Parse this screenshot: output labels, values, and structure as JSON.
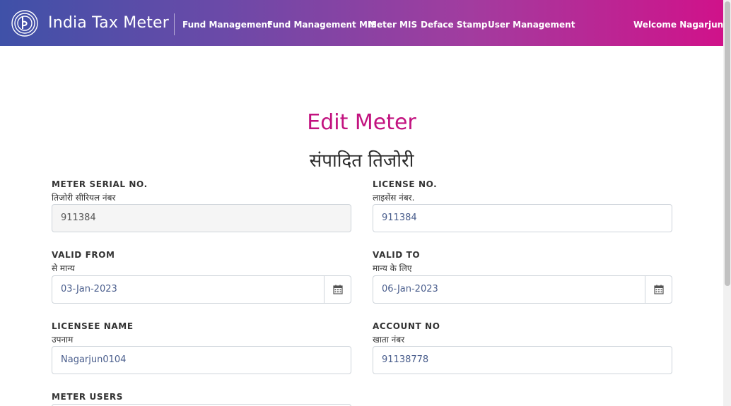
{
  "navbar": {
    "brand": "India Tax Meter",
    "links": [
      {
        "label": "Fund Management"
      },
      {
        "label": "Fund Management MIS"
      },
      {
        "label": "Meter MIS"
      },
      {
        "label": "Deface Stamp"
      },
      {
        "label": "User Management"
      }
    ],
    "welcome": "Welcome Nagarjun"
  },
  "page": {
    "title": "Edit Meter",
    "title_hindi": "संपादित तिजोरी"
  },
  "form": {
    "meter_serial": {
      "label": "METER SERIAL NO.",
      "label_hindi": "तिजोरी सीरियल नंबर",
      "value": "911384"
    },
    "license_no": {
      "label": "LICENSE NO.",
      "label_hindi": "लाइसेंस नंबर.",
      "value": "911384"
    },
    "valid_from": {
      "label": "VALID FROM",
      "label_hindi": "से मान्य",
      "value": "03-Jan-2023"
    },
    "valid_to": {
      "label": "VALID TO",
      "label_hindi": "मान्य के लिए",
      "value": "06-Jan-2023"
    },
    "licensee_name": {
      "label": "LICENSEE NAME",
      "label_hindi": "उपनाम",
      "value": "Nagarjun0104"
    },
    "account_no": {
      "label": "ACCOUNT NO",
      "label_hindi": "खाता नंबर",
      "value": "91138778"
    },
    "meter_users": {
      "label": "METER USERS"
    }
  },
  "icons": {
    "logo": "brand-logo-icon",
    "calendar": "calendar-icon"
  },
  "colors": {
    "gradient_start": "#3f51a8",
    "gradient_end": "#d0128a",
    "title_accent": "#c2127f"
  }
}
